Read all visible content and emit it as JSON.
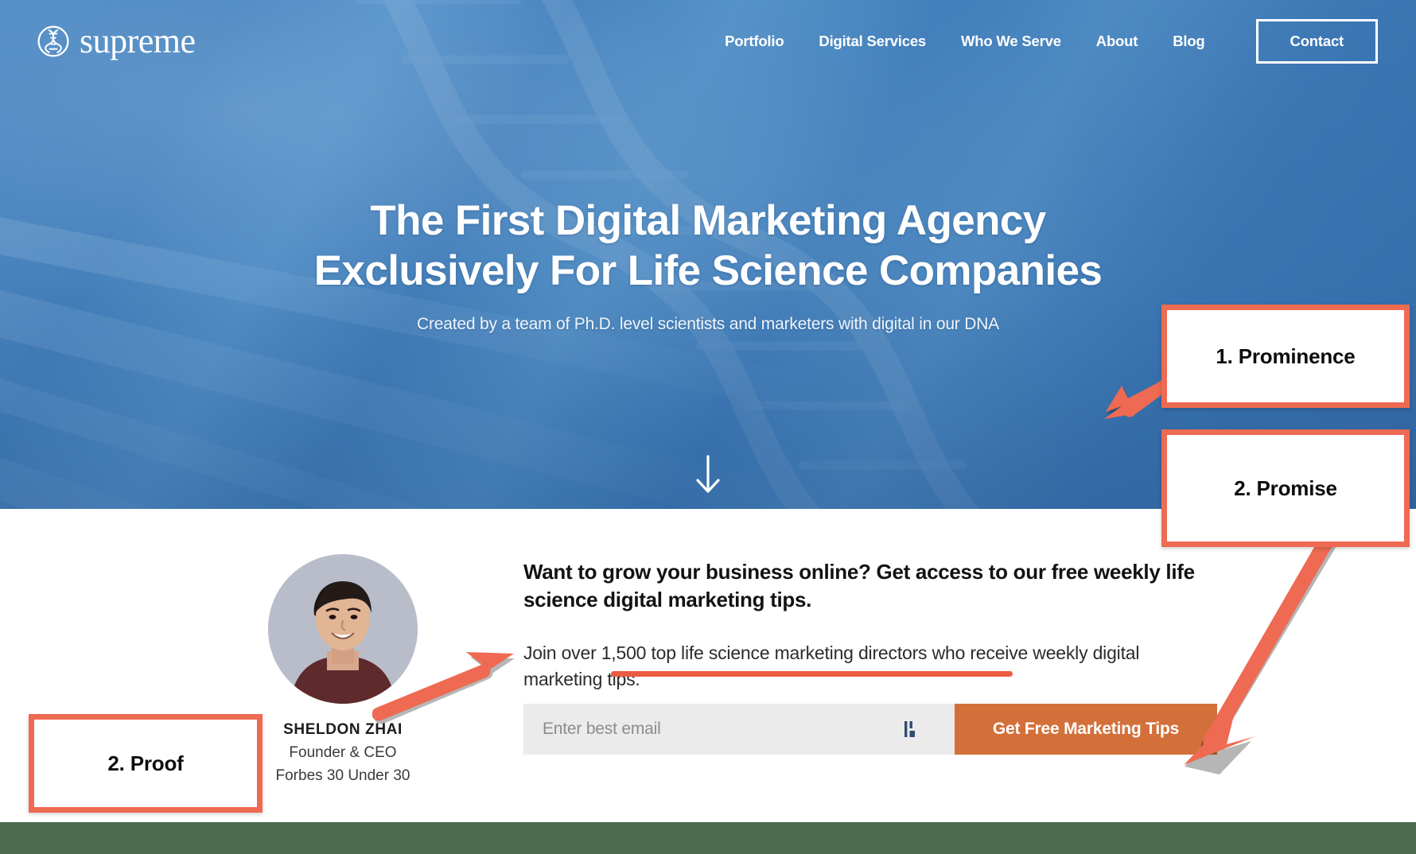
{
  "brand": {
    "name": "supreme",
    "logo_icon": "dna-circle-icon"
  },
  "nav": {
    "links": [
      {
        "label": "Portfolio"
      },
      {
        "label": "Digital Services"
      },
      {
        "label": "Who We Serve"
      },
      {
        "label": "About"
      },
      {
        "label": "Blog"
      }
    ],
    "cta": {
      "label": "Contact"
    }
  },
  "hero": {
    "title_line1": "The First Digital Marketing Agency",
    "title_line2": "Exclusively For Life Science Companies",
    "subtitle": "Created by a team of Ph.D. level scientists and marketers with digital in our DNA",
    "scroll_icon": "arrow-down-icon",
    "background_color": "#3f7dba"
  },
  "lead": {
    "person": {
      "name": "SHELDON ZHAI",
      "role": "Founder & CEO",
      "award": "Forbes 30 Under 30",
      "avatar_icon": "person-portrait-avatar"
    },
    "headline": "Want to grow your business online? Get access to our free weekly life science digital marketing tips.",
    "paragraph_before": "Join over ",
    "paragraph_highlight": "1,500 top life science marketing directors",
    "paragraph_after": " who receive weekly digital marketing tips.",
    "form": {
      "email_placeholder": "Enter best email",
      "email_value": "",
      "caret_icon": "text-cursor-icon",
      "submit_label": "Get Free Marketing Tips",
      "submit_color": "#d3703a"
    }
  },
  "annotations": {
    "accent_color": "#ee6a52",
    "items": [
      {
        "label": "1. Prominence"
      },
      {
        "label": "2. Promise"
      },
      {
        "label": "2. Proof"
      }
    ],
    "arrows": [
      {
        "name": "arrow-to-hero-headline"
      },
      {
        "name": "arrow-to-cta-button"
      },
      {
        "name": "arrow-to-proof-avatar"
      }
    ]
  },
  "footer": {
    "strip_color": "#4a6b4c"
  }
}
